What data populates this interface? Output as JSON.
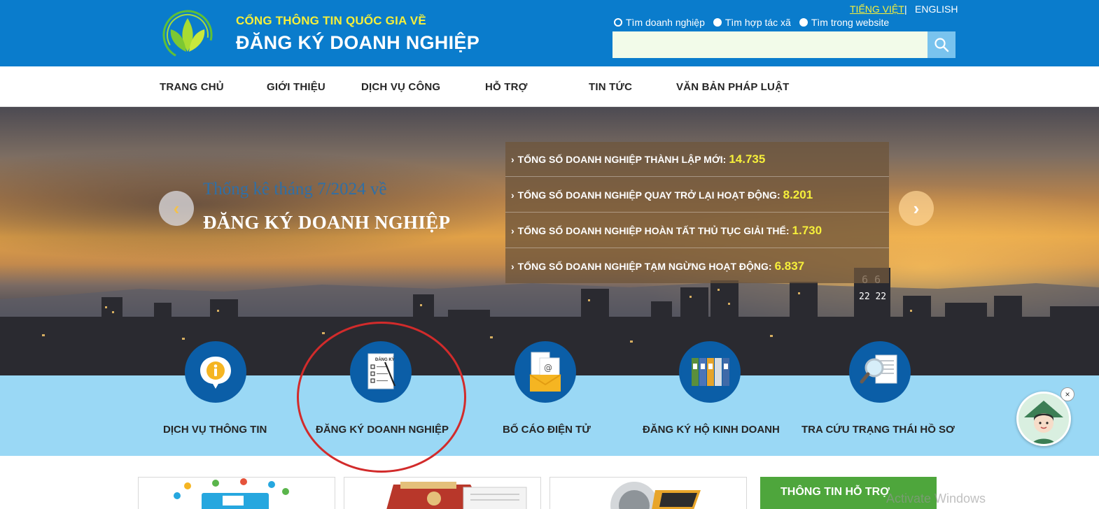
{
  "header": {
    "subtitle": "CỔNG THÔNG TIN QUỐC GIA VỀ",
    "title": "ĐĂNG KÝ DOANH NGHIỆP",
    "lang_vi": "TIẾNG VIỆT",
    "lang_sep": "|",
    "lang_en": "ENGLISH",
    "search_options": [
      "Tìm doanh nghiệp",
      "Tìm hợp tác xã",
      "Tìm trong website"
    ],
    "selected_option": "Tìm doanh nghiệp",
    "search_value": "",
    "search_icon": "search-icon",
    "accent": "#0a7ccc"
  },
  "nav": {
    "items": [
      "TRANG CHỦ",
      "GIỚI THIỆU",
      "DỊCH VỤ CÔNG",
      "HỖ TRỢ",
      "TIN TỨC",
      "VĂN BẢN PHÁP LUẬT"
    ]
  },
  "hero": {
    "caption_line1": "Thống kê tháng 7/2024 về",
    "caption_line2": "ĐĂNG KÝ DOANH NGHIỆP",
    "prev_icon": "chevron-left-icon",
    "next_icon": "chevron-right-icon",
    "stats": [
      {
        "label": "TỔNG SỐ DOANH NGHIỆP THÀNH LẬP MỚI:",
        "value": "14.735"
      },
      {
        "label": "TỔNG SỐ DOANH NGHIỆP QUAY TRỞ LẠI HOẠT ĐỘNG:",
        "value": "8.201"
      },
      {
        "label": "TỔNG SỐ DOANH NGHIỆP HOÀN TẤT THỦ TỤC GIẢI THỂ:",
        "value": "1.730"
      },
      {
        "label": "TỔNG SỐ DOANH NGHIỆP TẠM NGỪNG HOẠT ĐỘNG:",
        "value": "6.837"
      }
    ],
    "building_sign_top": "6 6",
    "building_sign_bottom": "22 22"
  },
  "services": {
    "items": [
      {
        "label": "DỊCH VỤ THÔNG TIN",
        "icon": "info-bubble-icon"
      },
      {
        "label": "ĐĂNG KÝ DOANH NGHIỆP",
        "icon": "registration-form-icon"
      },
      {
        "label": "BỐ CÁO ĐIỆN TỬ",
        "icon": "email-document-icon"
      },
      {
        "label": "ĐĂNG KÝ HỘ KINH DOANH",
        "icon": "binders-icon"
      },
      {
        "label": "TRA CỨU TRẠNG THÁI HỒ SƠ",
        "icon": "magnifier-document-icon"
      }
    ],
    "form_heading": "ĐĂNG KÝ",
    "band_color": "#9ad8f5",
    "highlight_color": "#d22b2b"
  },
  "bottom": {
    "support_tab": "THÔNG TIN HỖ TRỢ",
    "watermark": "Activate Windows",
    "chatbot_close": "×"
  }
}
